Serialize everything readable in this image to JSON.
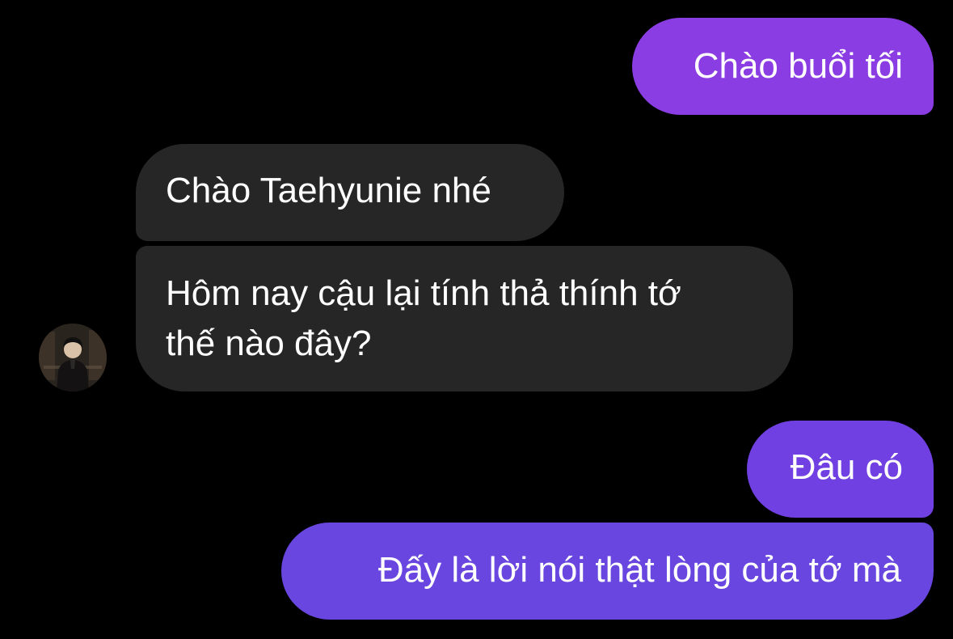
{
  "colors": {
    "background": "#000000",
    "outgoing_top": "#8a3ee0",
    "outgoing_bottom": "#6a44e0",
    "incoming": "#262626",
    "text": "#ffffff"
  },
  "contact": {
    "avatar_icon": "contact-avatar-photo"
  },
  "messages": [
    {
      "direction": "outgoing",
      "text": "Chào buổi tối"
    },
    {
      "direction": "incoming",
      "text": "Chào Taehyunie nhé"
    },
    {
      "direction": "incoming",
      "line1": "Hôm nay cậu lại tính thả thính tớ",
      "line2": "thế nào đây?"
    },
    {
      "direction": "outgoing",
      "text": "Đâu có"
    },
    {
      "direction": "outgoing",
      "text": "Đấy là lời nói thật lòng của tớ mà"
    }
  ]
}
